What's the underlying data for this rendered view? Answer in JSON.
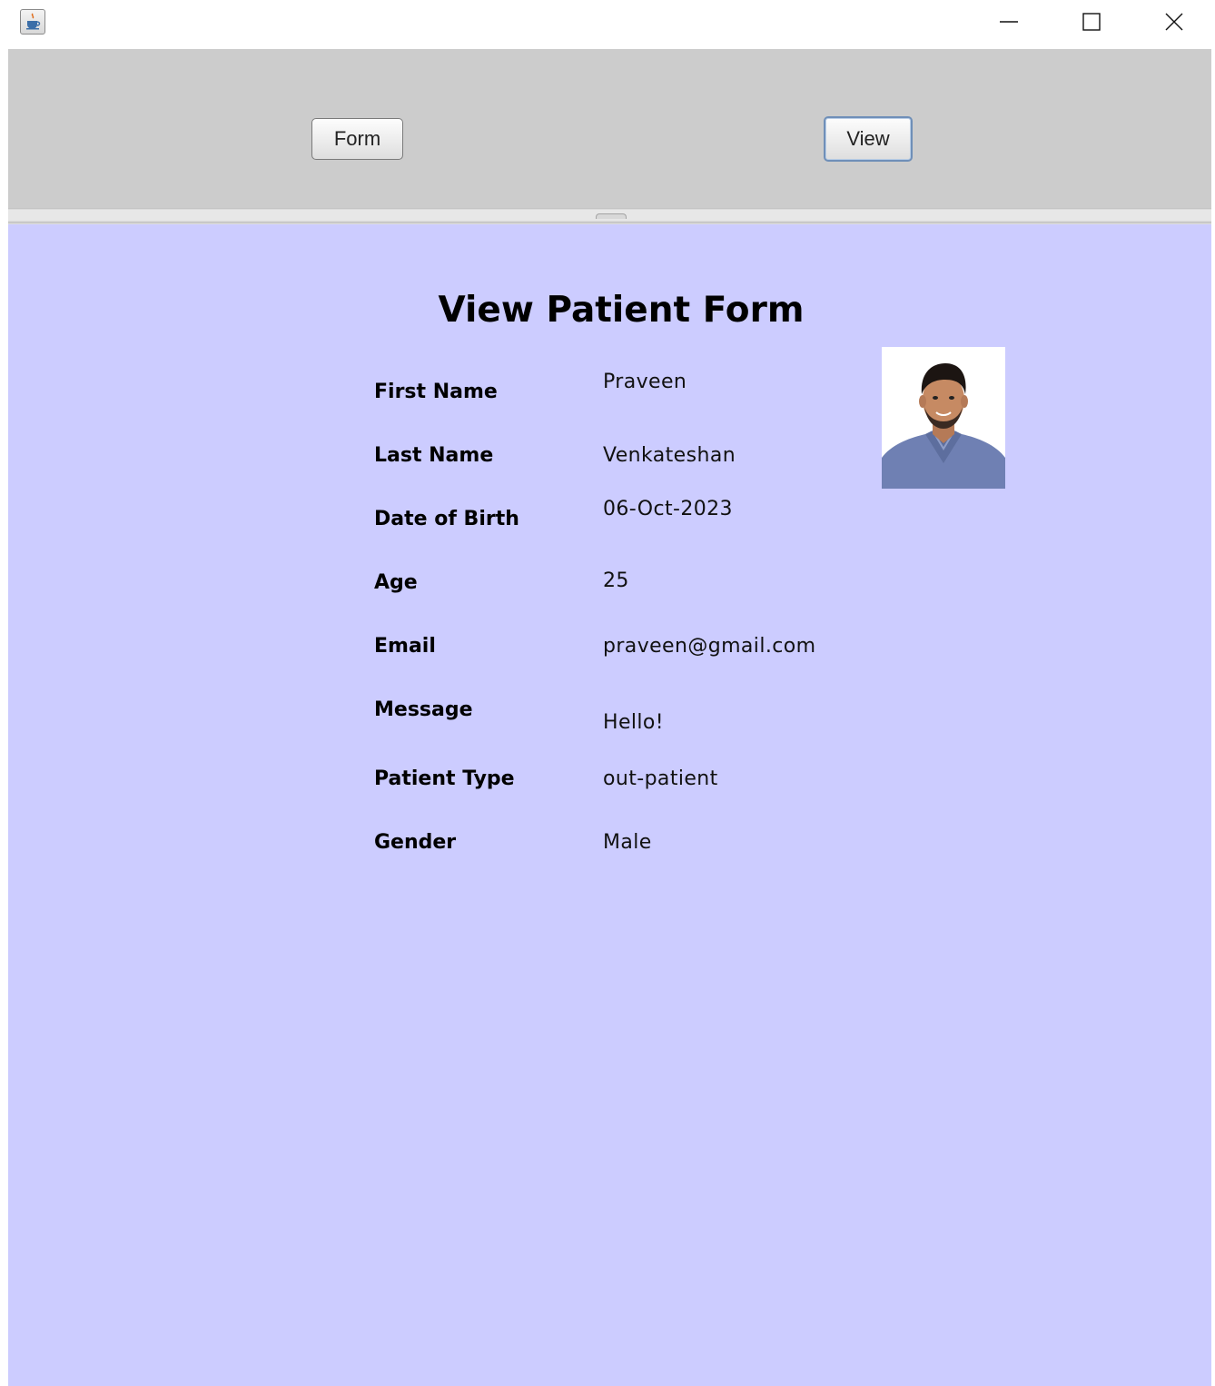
{
  "window": {
    "app_icon": "java-coffee-cup-icon",
    "controls": {
      "minimize": "minimize-icon",
      "maximize": "maximize-icon",
      "close": "close-icon"
    }
  },
  "toolbar": {
    "form_button_label": "Form",
    "view_button_label": "View"
  },
  "panel": {
    "title": "View Patient Form",
    "background_color": "#ccccff",
    "photo": "patient-photo",
    "fields": {
      "first_name": {
        "label": "First Name",
        "value": "Praveen"
      },
      "last_name": {
        "label": "Last Name",
        "value": "Venkateshan"
      },
      "dob": {
        "label": "Date of Birth",
        "value": "06-Oct-2023"
      },
      "age": {
        "label": "Age",
        "value": "25"
      },
      "email": {
        "label": "Email",
        "value": "praveen@gmail.com"
      },
      "message": {
        "label": "Message",
        "value": "Hello!"
      },
      "patient_type": {
        "label": "Patient Type",
        "value": "out-patient"
      },
      "gender": {
        "label": "Gender",
        "value": "Male"
      }
    }
  }
}
